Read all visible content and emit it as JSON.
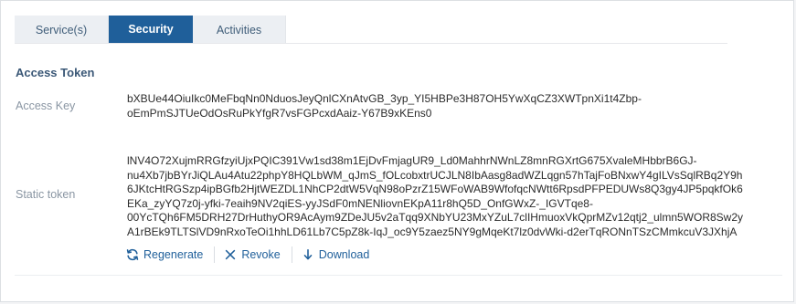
{
  "tabs": [
    {
      "label": "Service(s)"
    },
    {
      "label": "Security"
    },
    {
      "label": "Activities"
    }
  ],
  "section": {
    "title": "Access Token"
  },
  "access_key": {
    "label": "Access Key",
    "lines": [
      "bXBUe44OiuIkc0MeFbqNn0NduosJeyQnlCXnAtvGB_3yp_YI5HBPe3H87OH5YwXqCZ3XWTpnXi1t4Zbp-",
      "oEmPmSJTUeOdOsRuPkYfgR7vsFGPcxdAaiz-Y67B9xKEns0"
    ]
  },
  "static_token": {
    "label": "Static token",
    "lines": [
      "lNV4O72XujmRRGfzyiUjxPQIC391Vw1sd38m1EjDvFmjagUR9_Ld0MahhrNWnLZ8mnRGXrtG675XvaleMHbbrB6GJ-",
      "nu4Xb7jbBYrJiQLAu4Atu22phpY8HQLbWM_qJmS_fOLcobxtrUCJLN8IbAasg8adWZLqgn57hTajFoBNxwY4gILVsSqlRBq2Y9h",
      "6JKtcHtRGSzp4ipBGfb2HjtWEZDL1NhCP2dtW5VqN98oPzrZ15WFoWAB9WfofqcNWtt6RpsdPFPEDUWs8Q3gy4JP5pqkfOk6",
      "EKa_zyYQ7z0j-yfki-7eaih9NV2qiES-yyJSdF0mNENliovnEKpA11r8hQ5D_OnfGWxZ-_IGVTqe8-",
      "00YcTQh6FM5DRH27DrHuthyOR9AcAym9ZDeJU5v2aTqq9XNbYU23MxYZuL7clIHmuoxVkQprMZv12qtj2_ulmn5WOR8Sw2y",
      "A1rBEk9TLTSlVD9nRxoTeOi1hhLD61Lb7C5pZ8k-IqJ_oc9Y5zaez5NY9gMqeKt7lz0dvWki-d2erTqRONnTSzCMmkcuV3JXhjA"
    ]
  },
  "actions": {
    "regenerate": "Regenerate",
    "revoke": "Revoke",
    "download": "Download"
  },
  "colors": {
    "accent": "#1f5f9a",
    "section_title": "#3b5877",
    "label": "#8a96a3"
  },
  "icons": {
    "regenerate": "refresh-icon",
    "revoke": "close-icon",
    "download": "download-icon"
  }
}
